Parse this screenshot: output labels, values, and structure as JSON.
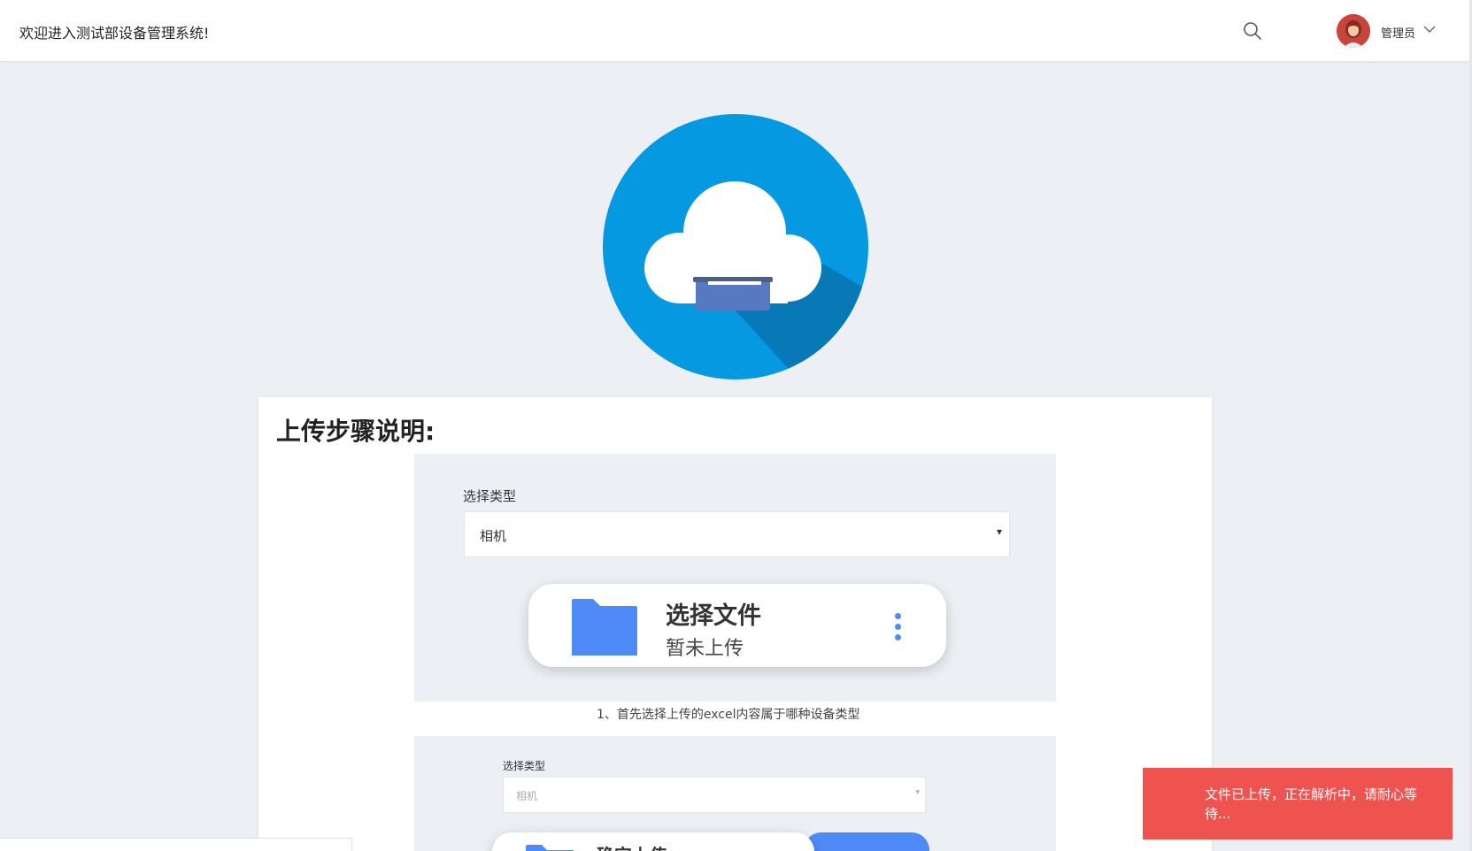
{
  "header": {
    "title": "欢迎进入测试部设备管理系统!",
    "user_name": "管理员",
    "icons": {
      "search": "search-icon",
      "chevron": "chevron-down-icon",
      "avatar": "avatar"
    }
  },
  "hero": {
    "icon": "cloud-upload-icon",
    "colors": {
      "circle": "#0599e2",
      "shadow": "#0679b6",
      "box": "#5679c2"
    }
  },
  "card": {
    "title": "上传步骤说明:",
    "step1": {
      "select_label": "选择类型",
      "select_value": "相机",
      "file_title": "选择文件",
      "file_status": "暂未上传",
      "caption": "1、首先选择上传的excel内容属于哪种设备类型"
    },
    "step2": {
      "select_label": "选择类型",
      "select_value": "相机",
      "file_title": "确定上传"
    }
  },
  "toast": {
    "message": "文件已上传，正在解析中，请耐心等待..."
  },
  "colors": {
    "accent": "#4f8bf7",
    "toast": "#ef5350",
    "background": "#eceff4"
  }
}
